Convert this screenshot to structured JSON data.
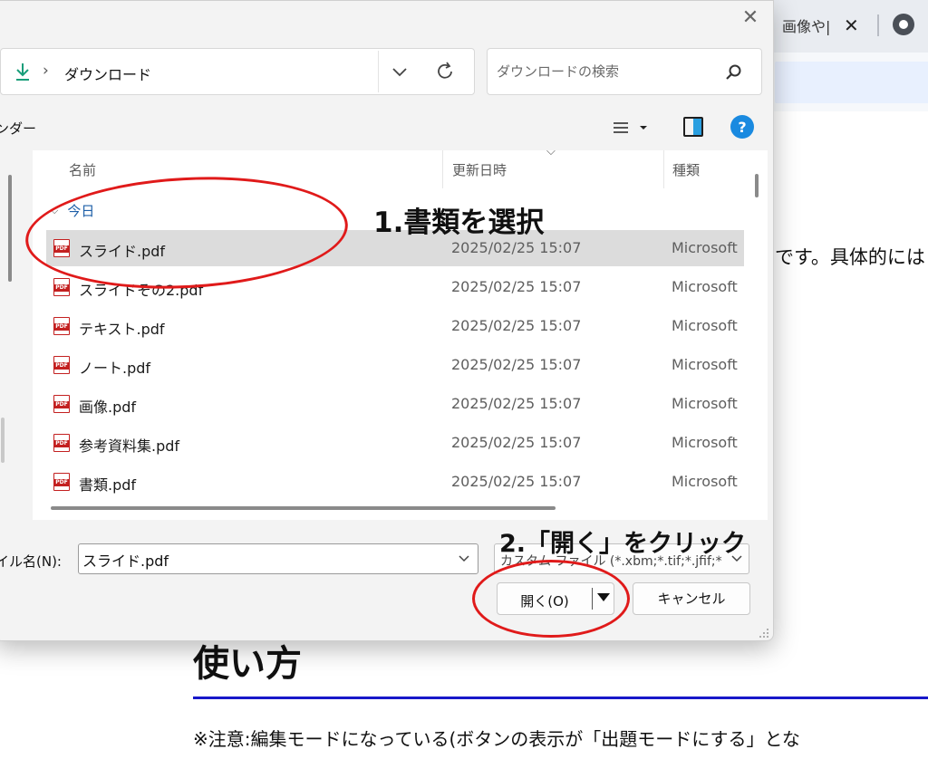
{
  "background_browser": {
    "tab_title": "画像や|",
    "tab_close": "✕",
    "body_text_line": "です。具体的には",
    "heading": "使い方",
    "note_text": "※注意:編集モードになっている(ボタンの表示が「出題モードにする」とな"
  },
  "dialog": {
    "close_glyph": "✕",
    "address": {
      "path_chevron": "›",
      "location": "ダウンロード"
    },
    "search": {
      "placeholder": "ダウンロードの検索"
    },
    "commandbar": {
      "left_label": "ンダー"
    },
    "help_label": "?",
    "columns": {
      "name": "名前",
      "date": "更新日時",
      "type": "種類"
    },
    "group_label": "今日",
    "pdf_badge": "PDF",
    "files": [
      {
        "name": "スライド.pdf",
        "date": "2025/02/25 15:07",
        "type": "Microsoft"
      },
      {
        "name": "スライドその2.pdf",
        "date": "2025/02/25 15:07",
        "type": "Microsoft"
      },
      {
        "name": "テキスト.pdf",
        "date": "2025/02/25 15:07",
        "type": "Microsoft"
      },
      {
        "name": "ノート.pdf",
        "date": "2025/02/25 15:07",
        "type": "Microsoft"
      },
      {
        "name": "画像.pdf",
        "date": "2025/02/25 15:07",
        "type": "Microsoft"
      },
      {
        "name": "参考資料集.pdf",
        "date": "2025/02/25 15:07",
        "type": "Microsoft"
      },
      {
        "name": "書類.pdf",
        "date": "2025/02/25 15:07",
        "type": "Microsoft"
      }
    ],
    "selected_file_index": 0,
    "filename_label": "イル名(N):",
    "filename_value": "スライド.pdf",
    "filetype_value": "カスタム ファイル (*.xbm;*.tif;*.jfif;*",
    "open_label": "開く(O)",
    "cancel_label": "キャンセル"
  },
  "annotations": {
    "step1": "1.書類を選択",
    "step2": "2.「開く」をクリック",
    "color": "#e01a1a"
  },
  "colors": {
    "accent_blue": "#1a8ae0",
    "selection_gray": "#dcdcdc",
    "pdf_red": "#c32020",
    "download_green": "#1a9e7a",
    "heading_rule_blue": "#1717c9"
  }
}
